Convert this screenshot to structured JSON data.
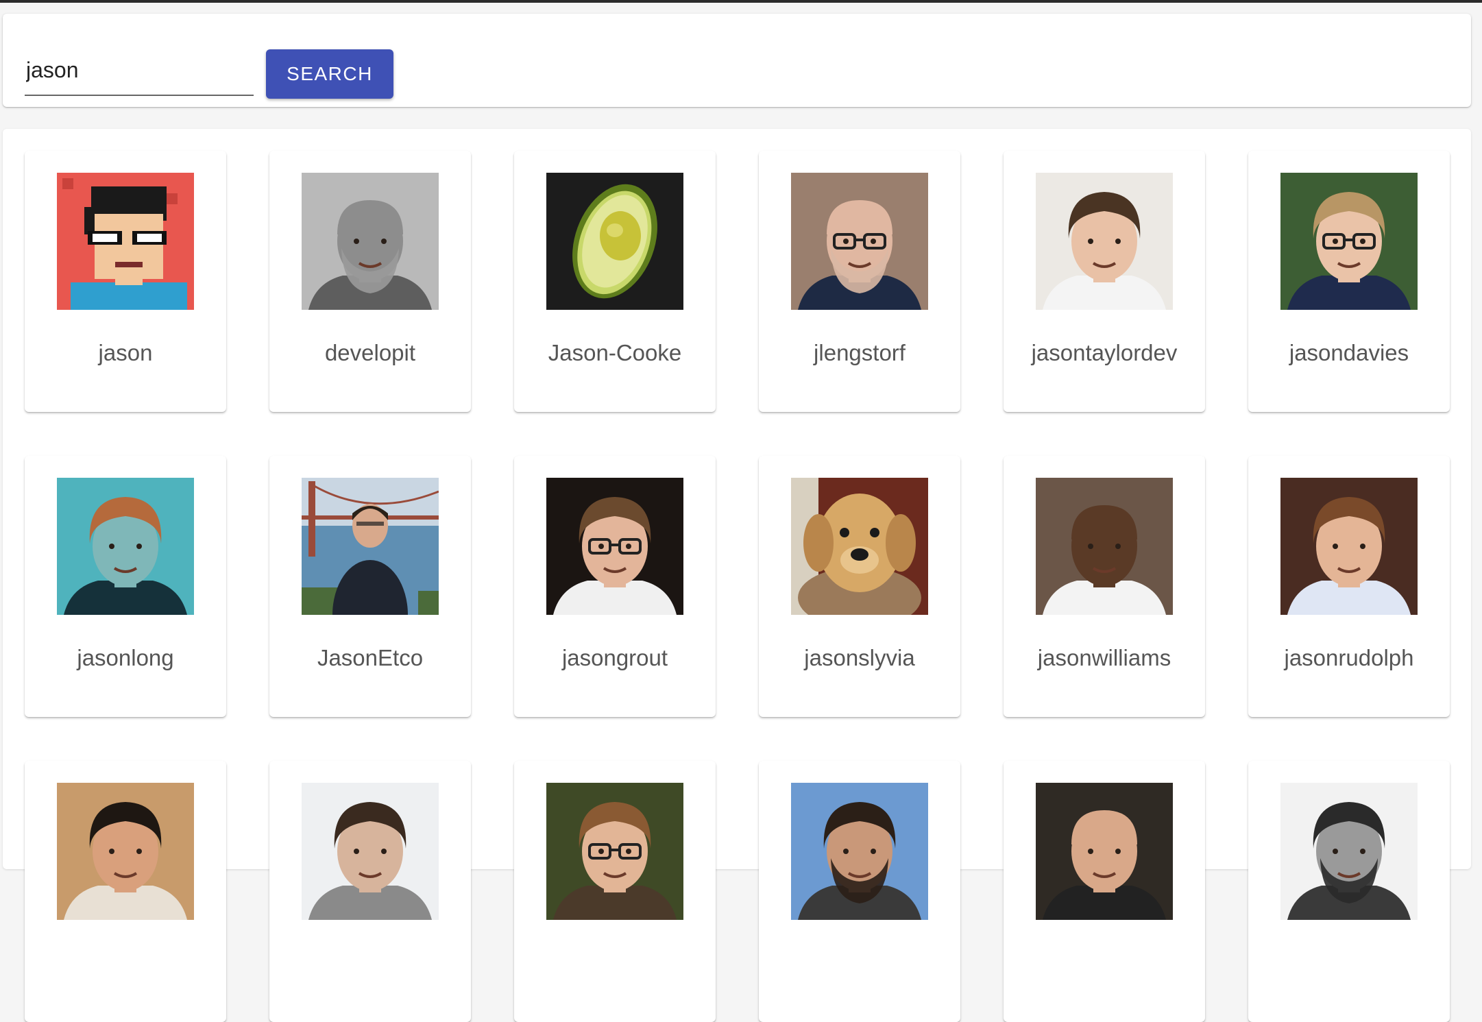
{
  "search": {
    "value": "jason",
    "button_label": "SEARCH"
  },
  "results": [
    {
      "username": "jason",
      "avatar": {
        "kind": "pixel",
        "bg": "#e8574f",
        "skin": "#f2c79d",
        "shirt": "#2f9fcf",
        "hair": "#1a1a1a"
      }
    },
    {
      "username": "developit",
      "avatar": {
        "kind": "person",
        "bg": "#b9b9b9",
        "skin": "#8d8d8d",
        "shirt": "#5e5e5e",
        "hair": "#9a9a9a",
        "beard": true,
        "glasses": false,
        "bald": true
      }
    },
    {
      "username": "Jason-Cooke",
      "avatar": {
        "kind": "avocado",
        "bg": "#1c1c1c"
      }
    },
    {
      "username": "jlengstorf",
      "avatar": {
        "kind": "person",
        "bg": "#9a7f6e",
        "skin": "#e0b7a1",
        "shirt": "#1e2a44",
        "hair": "#d9b8a4",
        "beard": true,
        "glasses": true,
        "bald": true
      }
    },
    {
      "username": "jasontaylordev",
      "avatar": {
        "kind": "person",
        "bg": "#ece9e4",
        "skin": "#e9c1a6",
        "shirt": "#f4f4f4",
        "hair": "#4a3423",
        "beard": false,
        "glasses": false,
        "bald": false
      }
    },
    {
      "username": "jasondavies",
      "avatar": {
        "kind": "person",
        "bg": "#3d5e34",
        "skin": "#eac3a8",
        "shirt": "#1f2b4d",
        "hair": "#b89665",
        "beard": false,
        "glasses": true,
        "bald": false
      }
    },
    {
      "username": "jasonlong",
      "avatar": {
        "kind": "person",
        "bg": "#4fb3bd",
        "skin": "#7fb7b8",
        "shirt": "#15313a",
        "hair": "#b56a3c",
        "beard": false,
        "glasses": false,
        "bald": false
      }
    },
    {
      "username": "JasonEtco",
      "avatar": {
        "kind": "bridge",
        "bg": "#7fa7c7",
        "skin": "#d8a98c",
        "shirt": "#1f2530",
        "hair": "#2a2118"
      }
    },
    {
      "username": "jasongrout",
      "avatar": {
        "kind": "person",
        "bg": "#1b1512",
        "skin": "#e3b59a",
        "shirt": "#f0f0f0",
        "hair": "#6b4a2e",
        "beard": false,
        "glasses": true,
        "bald": false
      }
    },
    {
      "username": "jasonslyvia",
      "avatar": {
        "kind": "dog",
        "bg": "#6b2a1e"
      }
    },
    {
      "username": "jasonwilliams",
      "avatar": {
        "kind": "person",
        "bg": "#6b5648",
        "skin": "#5a3a26",
        "shirt": "#f3f3f3",
        "hair": "#1a120d",
        "beard": false,
        "glasses": false,
        "bald": true
      }
    },
    {
      "username": "jasonrudolph",
      "avatar": {
        "kind": "person",
        "bg": "#4a2c22",
        "skin": "#e4b596",
        "shirt": "#dfe6f4",
        "hair": "#7a4a2a",
        "beard": false,
        "glasses": false,
        "bald": false
      }
    },
    {
      "username": "",
      "avatar": {
        "kind": "person",
        "bg": "#c89b6b",
        "skin": "#d9a07c",
        "shirt": "#e8e0d4",
        "hair": "#1e1712",
        "beard": false,
        "glasses": false,
        "bald": false
      }
    },
    {
      "username": "",
      "avatar": {
        "kind": "person",
        "bg": "#eef0f2",
        "skin": "#d7b49c",
        "shirt": "#8a8a8a",
        "hair": "#3a2a1f",
        "beard": false,
        "glasses": false,
        "bald": false
      }
    },
    {
      "username": "",
      "avatar": {
        "kind": "person",
        "bg": "#3f4a26",
        "skin": "#e2b596",
        "shirt": "#4b3a2a",
        "hair": "#8a5a33",
        "beard": false,
        "glasses": true,
        "bald": false
      }
    },
    {
      "username": "",
      "avatar": {
        "kind": "person",
        "bg": "#6c9ad1",
        "skin": "#c99879",
        "shirt": "#3a3a3a",
        "hair": "#2b1f17",
        "beard": true,
        "glasses": false,
        "bald": false
      }
    },
    {
      "username": "",
      "avatar": {
        "kind": "person",
        "bg": "#2f2a24",
        "skin": "#d9a889",
        "shirt": "#222222",
        "hair": "#c69c82",
        "beard": false,
        "glasses": false,
        "bald": true
      }
    },
    {
      "username": "",
      "avatar": {
        "kind": "person",
        "bg": "#f2f2f2",
        "skin": "#9a9a9a",
        "shirt": "#3a3a3a",
        "hair": "#2a2a2a",
        "beard": true,
        "glasses": false,
        "bald": false
      }
    }
  ]
}
